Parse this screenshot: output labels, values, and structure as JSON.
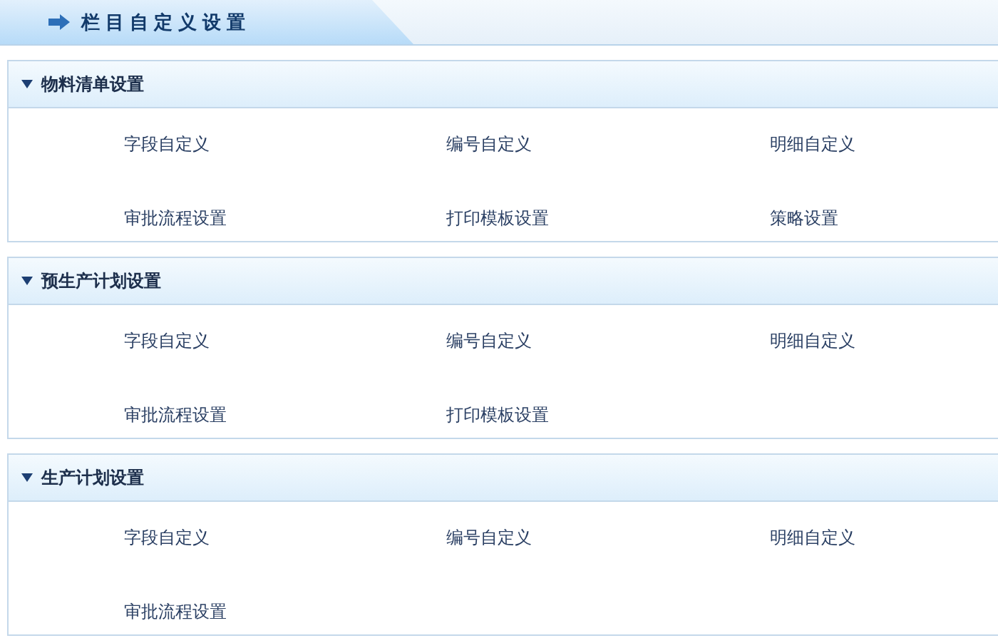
{
  "page_title": "栏目自定义设置",
  "sections": [
    {
      "title": "物料清单设置",
      "expanded": true,
      "items": [
        "字段自定义",
        "编号自定义",
        "明细自定义",
        "审批流程设置",
        "打印模板设置",
        "策略设置"
      ]
    },
    {
      "title": "预生产计划设置",
      "expanded": true,
      "items": [
        "字段自定义",
        "编号自定义",
        "明细自定义",
        "审批流程设置",
        "打印模板设置"
      ]
    },
    {
      "title": "生产计划设置",
      "expanded": true,
      "items": [
        "字段自定义",
        "编号自定义",
        "明细自定义",
        "审批流程设置"
      ]
    }
  ]
}
